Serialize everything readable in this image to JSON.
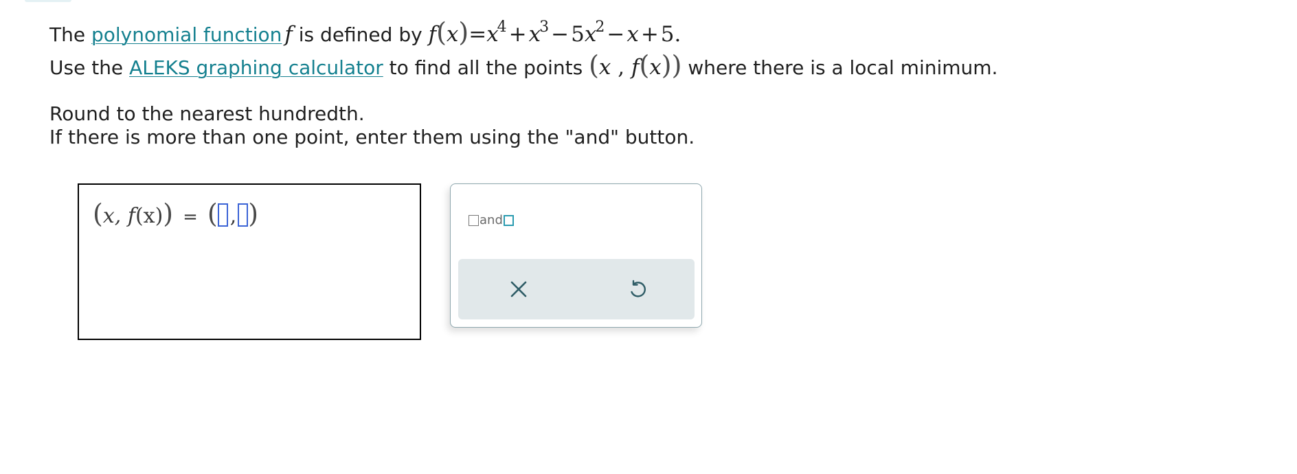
{
  "question": {
    "line1": {
      "prefix": "The ",
      "link": "polynomial function",
      "f": "f",
      "middle": " is defined by ",
      "expr": {
        "f": "f",
        "lp": "(",
        "x": "x",
        "rp": ")",
        "eq": "=",
        "t1": "x",
        "e1": "4",
        "plus1": "+",
        "t2": "x",
        "e2": "3",
        "minus1": "−",
        "coef3": "5",
        "t3": "x",
        "e3": "2",
        "minus2": "−",
        "t4": "x",
        "plus2": "+",
        "const": "5."
      }
    },
    "line2": {
      "prefix": "Use the ",
      "link": "ALEKS graphing calculator",
      "middle": " to find all the points ",
      "point": {
        "lp": "(",
        "x": "x",
        "comma": " , ",
        "f": "f",
        "lp2": "(",
        "x2": "x",
        "rp": "))"
      },
      "suffix": " where there is a local minimum."
    },
    "instruction1": "Round to the nearest hundredth.",
    "instruction2": "If there is more than one point, enter them using the \"and\" button."
  },
  "answer": {
    "lhs_open": "(",
    "lhs_x": "x,",
    "lhs_f": "f",
    "lhs_arg": "(x)",
    "lhs_close": ")",
    "equals": "=",
    "rhs_open": "(",
    "rhs_comma": ",",
    "rhs_close": ")",
    "slot1_value": "",
    "slot2_value": ""
  },
  "palette": {
    "and_label": "and",
    "clear_icon": "close-icon",
    "undo_icon": "undo-icon"
  },
  "colors": {
    "link": "#14808f",
    "slot_border": "#3b63d6",
    "palette_border": "#8da6ad",
    "action_bar": "#e1e8ea",
    "icon": "#2e5c66"
  }
}
